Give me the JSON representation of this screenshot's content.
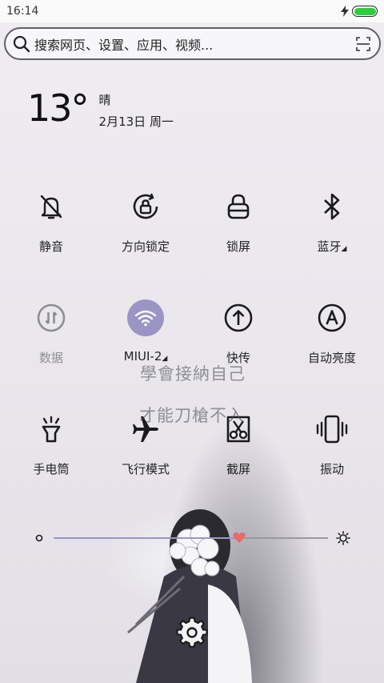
{
  "status_bar": {
    "time": "16:14",
    "battery_level": 1.0,
    "battery_color": "#2ecc40",
    "charging_icon": "bolt-icon"
  },
  "search": {
    "placeholder": "搜索网页、设置、应用、视频...",
    "left_icon": "search-icon",
    "right_icon": "scan-icon"
  },
  "weather": {
    "temperature": "13°",
    "condition": "晴",
    "date": "2月13日 周一"
  },
  "toggles": [
    {
      "label": "静音",
      "icon": "bell-off-icon",
      "active": false
    },
    {
      "label": "方向锁定",
      "icon": "rotation-lock-icon",
      "active": false
    },
    {
      "label": "锁屏",
      "icon": "lock-icon",
      "active": false
    },
    {
      "label": "蓝牙",
      "icon": "bluetooth-icon",
      "active": false,
      "has_menu": true
    },
    {
      "label": "数据",
      "icon": "mobile-data-icon",
      "active": false,
      "disabled": true
    },
    {
      "label": "MIUI-2",
      "icon": "wifi-icon",
      "active": true,
      "has_menu": true
    },
    {
      "label": "快传",
      "icon": "upload-icon",
      "active": false
    },
    {
      "label": "自动亮度",
      "icon": "auto-brightness-icon",
      "active": false
    },
    {
      "label": "手电筒",
      "icon": "flashlight-icon",
      "active": false
    },
    {
      "label": "飞行模式",
      "icon": "airplane-icon",
      "active": false
    },
    {
      "label": "截屏",
      "icon": "screenshot-icon",
      "active": false
    },
    {
      "label": "振动",
      "icon": "vibrate-icon",
      "active": false
    }
  ],
  "menu_marker": "◢",
  "wallpaper_text": {
    "line1": "學會接納自己",
    "line2": "才能刀槍不入"
  },
  "brightness": {
    "level": 0.7,
    "track_color": "#9b95c6",
    "thumb_color": "#e86a6a"
  },
  "colors": {
    "wifi_active": "#9b95c6",
    "disabled_text": "#8e8e92"
  }
}
